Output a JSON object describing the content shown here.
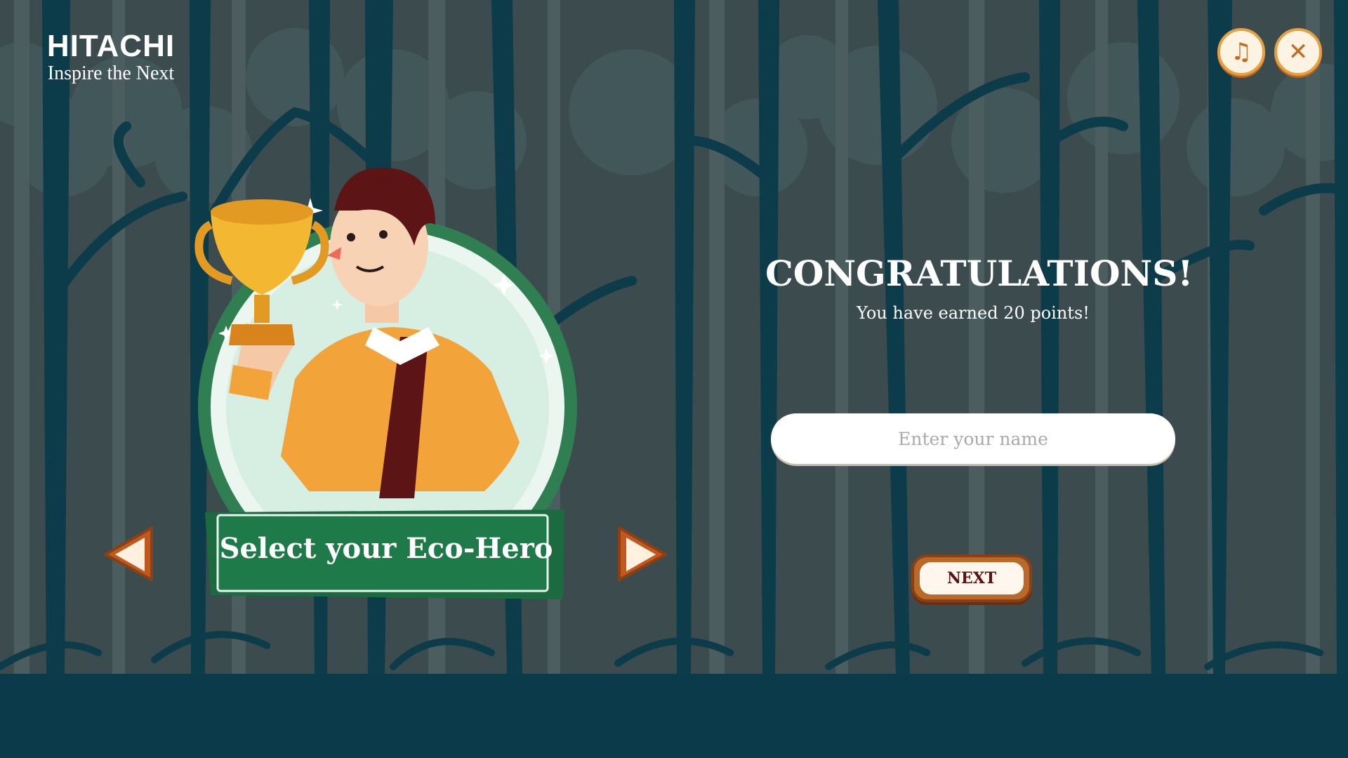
{
  "logo": {
    "brand": "HITACHI",
    "tagline": "Inspire the Next"
  },
  "controls": {
    "music_icon": "music-note-icon",
    "close_icon": "close-icon",
    "music_glyph": "♫",
    "close_glyph": "✕"
  },
  "result": {
    "title": "CONGRATULATIONS!",
    "message": "You have earned 20 points!"
  },
  "name_field": {
    "placeholder": "Enter your name",
    "value": ""
  },
  "next_button": {
    "label": "NEXT"
  },
  "hero_select": {
    "label": "Select your Eco-Hero",
    "prev_icon": "left-arrow-icon",
    "next_icon": "right-arrow-icon"
  },
  "colors": {
    "background": "#394a4d",
    "trees": "#0c3b4a",
    "accent_orange": "#e6a042",
    "banner_green": "#1f7a4a",
    "text_dark": "#5a1212"
  }
}
